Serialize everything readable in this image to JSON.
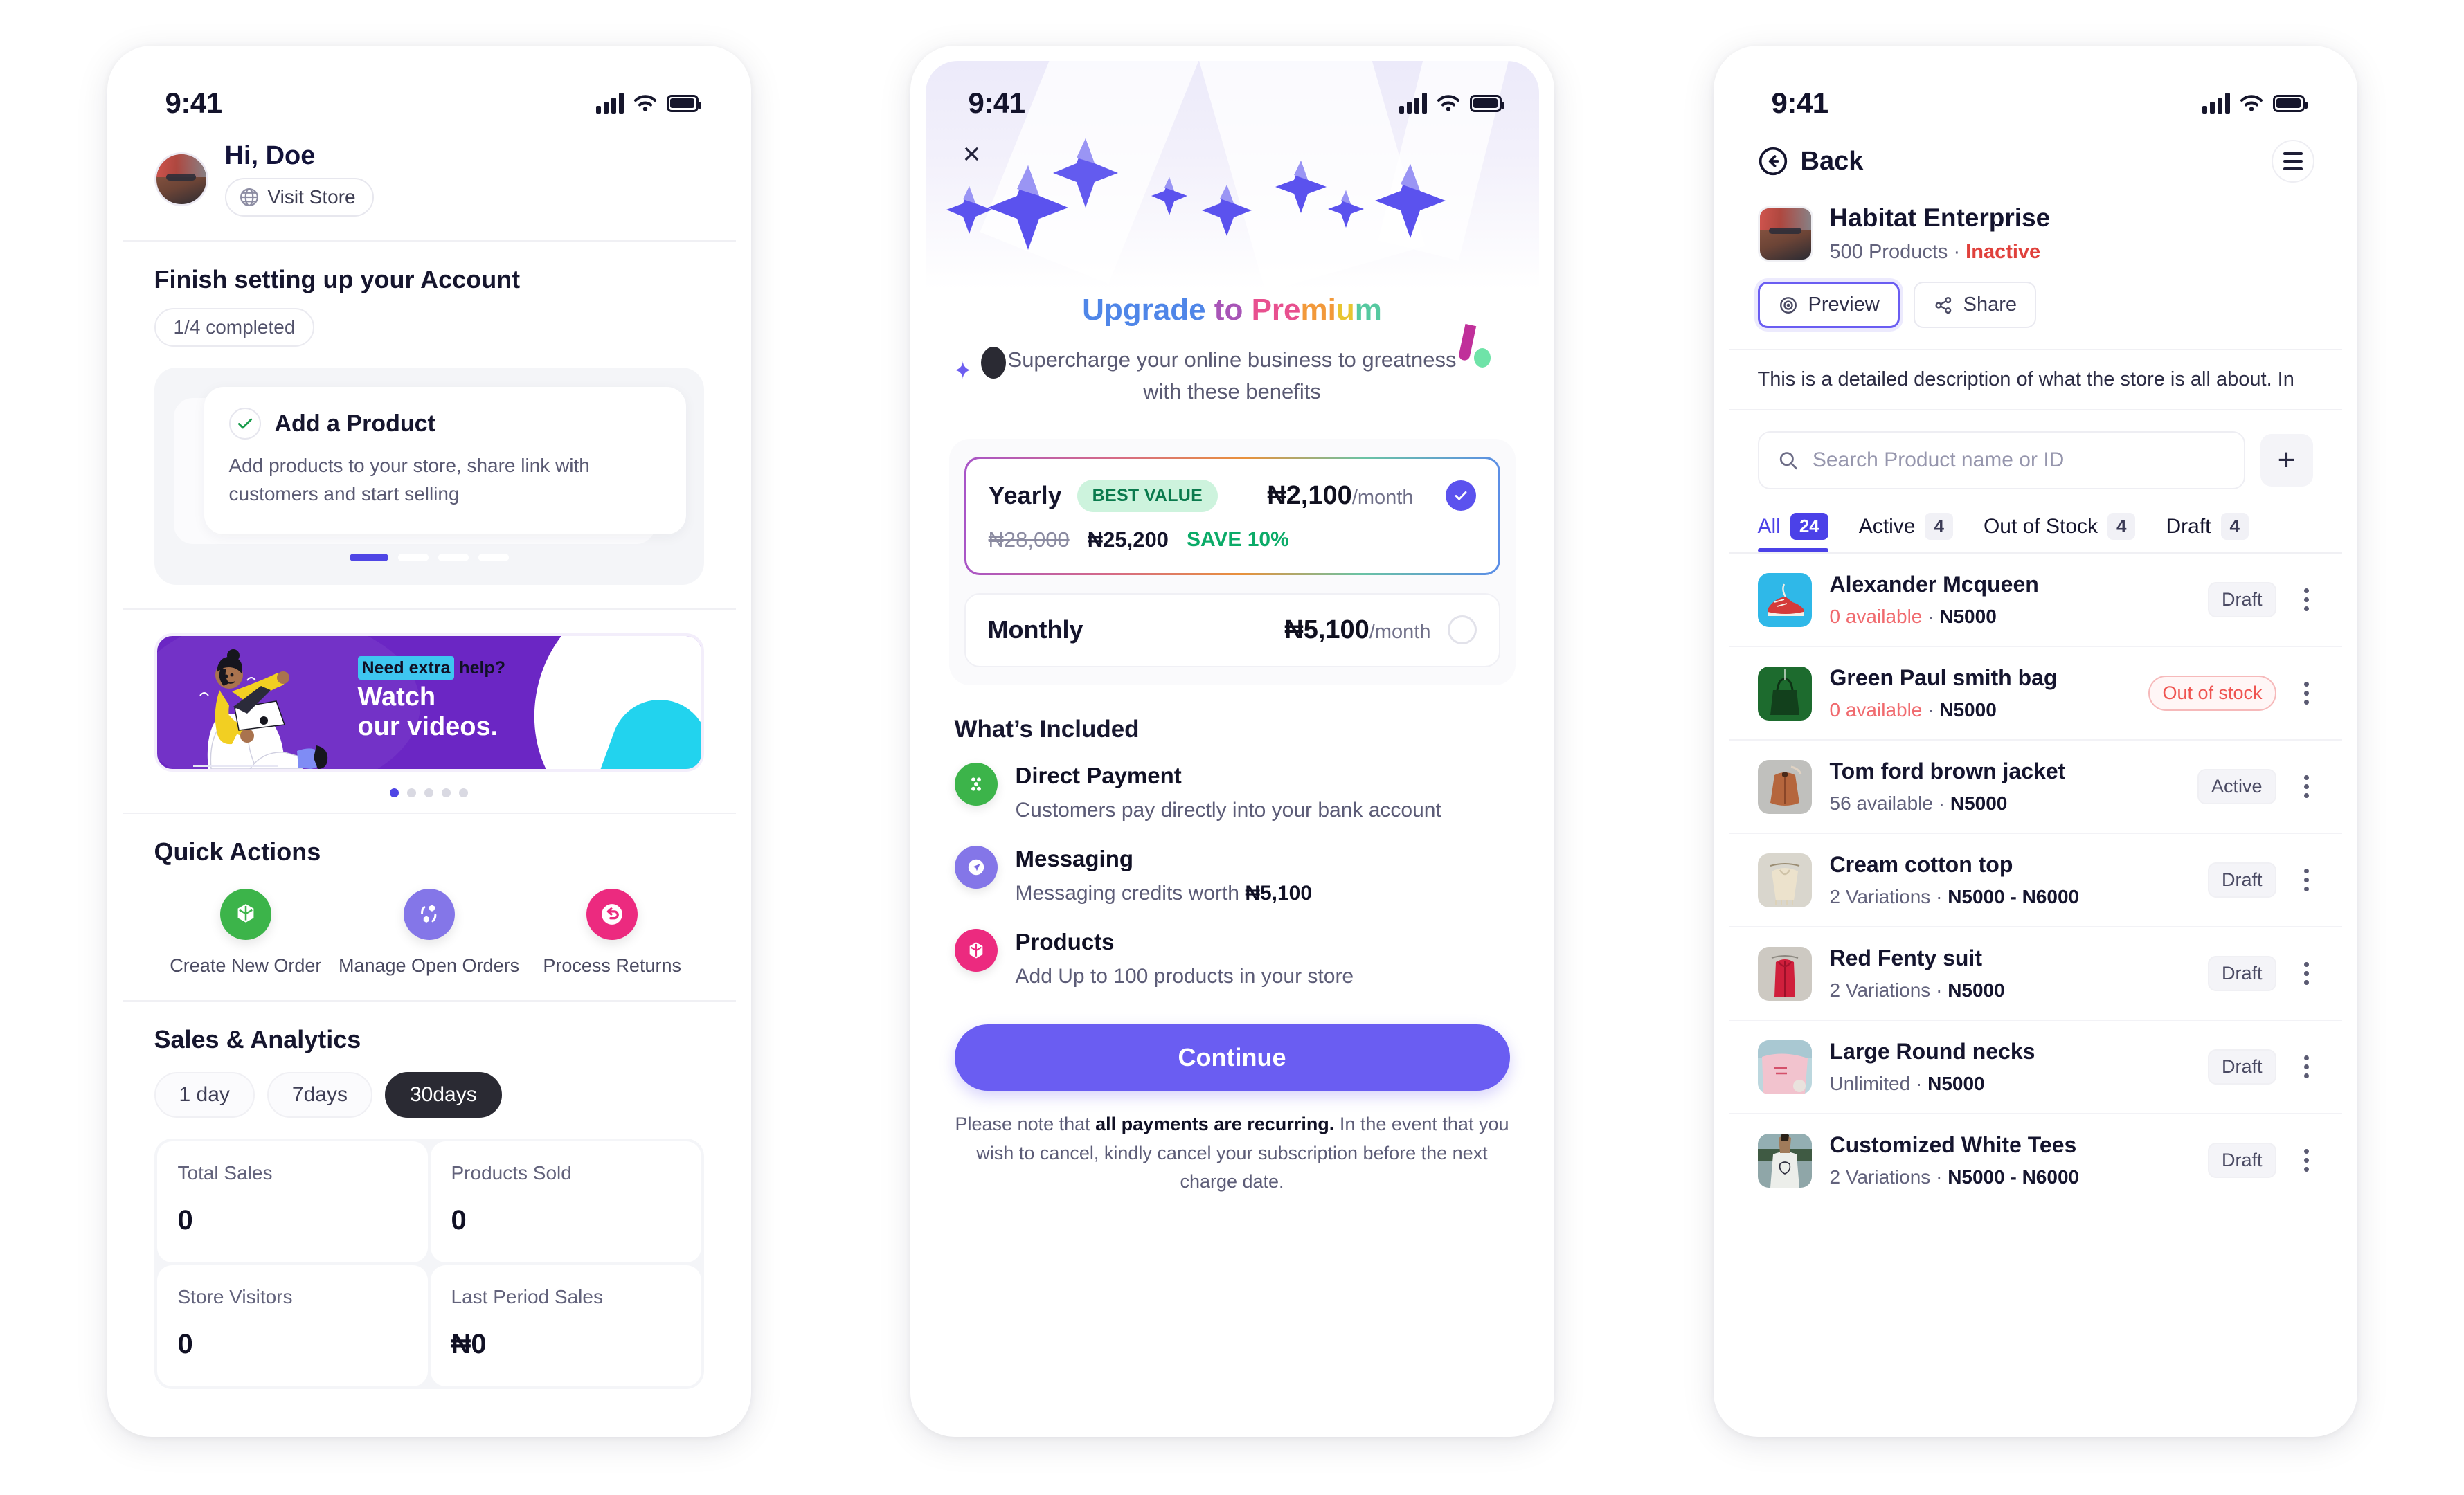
{
  "status_bar": {
    "time": "9:41",
    "icons": [
      "signal-bars-icon",
      "wifi-icon",
      "battery-icon"
    ]
  },
  "phone1": {
    "header": {
      "greeting": "Hi, Doe",
      "visit_store_label": "Visit Store",
      "avatar_name": "user-avatar"
    },
    "setup": {
      "title": "Finish setting up your Account",
      "progress_label": "1/4 completed",
      "card": {
        "title": "Add a Product",
        "description": "Add products to your store, share link with customers and start selling",
        "checked": true
      },
      "pager": {
        "count": 4,
        "active": 0
      }
    },
    "banner": {
      "eyebrow_highlight": "Need extra",
      "eyebrow_rest": " help?",
      "headline_line1": "Watch",
      "headline_line2": "our videos.",
      "bg_color": "#6b26c4",
      "highlight_color": "#3ec6f0",
      "pager": {
        "count": 5,
        "active": 0
      }
    },
    "quick_actions": {
      "title": "Quick Actions",
      "items": [
        {
          "label": "Create New Order",
          "icon": "cube-icon",
          "color": "#3cb44a"
        },
        {
          "label": "Manage Open Orders",
          "icon": "refresh-cubes-icon",
          "color": "#8476e8"
        },
        {
          "label": "Process Returns",
          "icon": "return-arrow-icon",
          "color": "#ec2a7f"
        }
      ]
    },
    "sales": {
      "title": "Sales & Analytics",
      "ranges": [
        {
          "label": "1 day",
          "selected": false
        },
        {
          "label": "7days",
          "selected": false
        },
        {
          "label": "30days",
          "selected": true
        }
      ],
      "stats": [
        {
          "label": "Total Sales",
          "value": "0"
        },
        {
          "label": "Products Sold",
          "value": "0"
        },
        {
          "label": "Store Visitors",
          "value": "0"
        },
        {
          "label": "Last Period Sales",
          "value": "₦0"
        }
      ]
    }
  },
  "phone2": {
    "close_label": "×",
    "title_parts": [
      "Upgrade",
      " to ",
      "Pre",
      "mi",
      "u",
      "m"
    ],
    "subtitle": "Supercharge your online business to greatness with these benefits",
    "plans": [
      {
        "name": "Yearly",
        "badge": "BEST VALUE",
        "price_main": "₦2,100",
        "price_suffix": "/month",
        "old_price": "₦28,000",
        "new_price": "₦25,200",
        "save": "SAVE 10%",
        "selected": true
      },
      {
        "name": "Monthly",
        "badge": "",
        "price_main": "₦5,100",
        "price_suffix": "/month",
        "old_price": "",
        "new_price": "",
        "save": "",
        "selected": false
      }
    ],
    "included_title": "What’s Included",
    "benefits": [
      {
        "title": "Direct Payment",
        "desc": "Customers pay directly into your bank account",
        "icon": "direct-payment-icon",
        "color": "#3cb44a"
      },
      {
        "title": "Messaging",
        "desc_pre": "Messaging credits worth ",
        "desc_bold": "₦5,100",
        "icon": "messaging-send-icon",
        "color": "#8476e8"
      },
      {
        "title": "Products",
        "desc": "Add Up to 100 products in your store",
        "icon": "products-cube-icon",
        "color": "#ec2a7f"
      }
    ],
    "cta_label": "Continue",
    "fine_print_pre": "Please note that ",
    "fine_print_bold": "all payments are recurring.",
    "fine_print_post": " In the event that you wish to cancel, kindly cancel your subscription before the next charge date."
  },
  "phone3": {
    "back_label": "Back",
    "menu_icon": "hamburger-menu-icon",
    "store": {
      "name": "Habitat Enterprise",
      "products_count": "500 Products",
      "separator": " · ",
      "status": "Inactive",
      "status_color": "#e0413c",
      "actions": [
        {
          "label": "Preview",
          "icon": "eye-icon",
          "primary": true
        },
        {
          "label": "Share",
          "icon": "share-nodes-icon",
          "primary": false
        }
      ],
      "description": "This is a detailed description  of what the store is all about. In"
    },
    "search": {
      "placeholder": "Search Product name or ID",
      "value": "",
      "icon": "search-icon"
    },
    "add_button": "+",
    "tabs": [
      {
        "label": "All",
        "count": "24",
        "selected": true
      },
      {
        "label": "Active",
        "count": "4",
        "selected": false
      },
      {
        "label": "Out of Stock",
        "count": "4",
        "selected": false
      },
      {
        "label": "Draft",
        "count": "4",
        "selected": false
      }
    ],
    "products": [
      {
        "name": "Alexander Mcqueen",
        "stock": "0 available",
        "stock_zero": true,
        "price": "N5000",
        "status": "Draft",
        "status_type": "draft",
        "thumb": "red-sneaker-photo",
        "c1": "#2fb8e8",
        "c2": "#d43a3a"
      },
      {
        "name": "Green Paul smith bag",
        "stock": "0 available",
        "stock_zero": true,
        "price": "N5000",
        "status": "Out of stock",
        "status_type": "oos",
        "thumb": "green-bag-photo",
        "c1": "#1d6b2e",
        "c2": "#0f3f1b"
      },
      {
        "name": "Tom ford brown jacket",
        "stock": "56 available",
        "stock_zero": false,
        "price": "N5000",
        "status": "Active",
        "status_type": "draft",
        "thumb": "brown-jacket-photo",
        "c1": "#c0c0bd",
        "c2": "#b5663d"
      },
      {
        "name": "Cream cotton top",
        "stock": "2 Variations",
        "stock_zero": false,
        "price": "N5000 - N6000",
        "status": "Draft",
        "status_type": "draft",
        "thumb": "cream-top-photo",
        "c1": "#d9d6cd",
        "c2": "#e8e0cd"
      },
      {
        "name": "Red Fenty suit",
        "stock": "2 Variations",
        "stock_zero": false,
        "price": "N5000",
        "status": "Draft",
        "status_type": "draft",
        "thumb": "red-suit-photo",
        "c1": "#cdc9c2",
        "c2": "#d01f3c"
      },
      {
        "name": "Large Round necks",
        "stock": "Unlimited",
        "stock_zero": false,
        "price": "N5000",
        "status": "Draft",
        "status_type": "draft",
        "thumb": "pink-shirt-photo",
        "c1": "#bcd7de",
        "c2": "#f2c3ce"
      },
      {
        "name": "Customized White Tees",
        "stock": "2 Variations",
        "stock_zero": false,
        "price": "N5000 - N6000",
        "status": "Draft",
        "status_type": "draft",
        "thumb": "white-tee-photo",
        "c1": "#8fa6a8",
        "c2": "#e6e8e3"
      }
    ]
  }
}
